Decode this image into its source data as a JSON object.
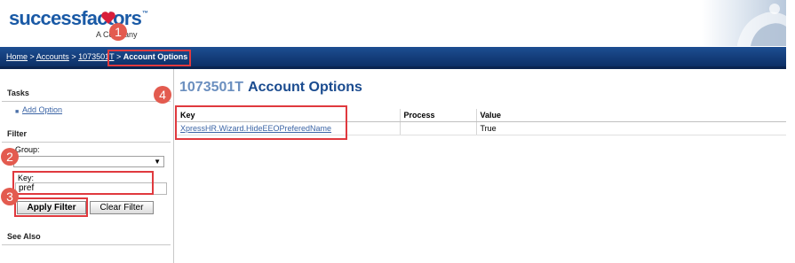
{
  "header": {
    "logo_text": "successfactors",
    "logo_tm": "™",
    "logo_tagline": "A    Company"
  },
  "breadcrumb": {
    "items": [
      "Home",
      "Accounts",
      "1073501T"
    ],
    "separator": " > ",
    "current": "Account Options"
  },
  "left_panel": {
    "tasks_title": "Tasks",
    "add_option_label": "Add Option",
    "filter_title": "Filter",
    "group_label": "Group:",
    "group_value": "",
    "key_label": "Key:",
    "key_value": "pref",
    "apply_filter_label": "Apply Filter",
    "clear_filter_label": "Clear Filter",
    "see_also_title": "See Also"
  },
  "main": {
    "title_id": "1073501T",
    "title_rest": "Account Options",
    "table": {
      "columns": [
        "Key",
        "Process",
        "Value"
      ],
      "rows": [
        {
          "key": "XpressHR.Wizard.HideEEOPreferedName",
          "process": "",
          "value": "True"
        }
      ]
    }
  },
  "annotations": {
    "markers": [
      "1",
      "2",
      "3",
      "4"
    ]
  },
  "colors": {
    "brand_blue": "#1a5aa6",
    "nav_bar": "#0c2f66",
    "link": "#3c65a6",
    "highlight": "#e0393e",
    "marker": "#e35b4f"
  }
}
